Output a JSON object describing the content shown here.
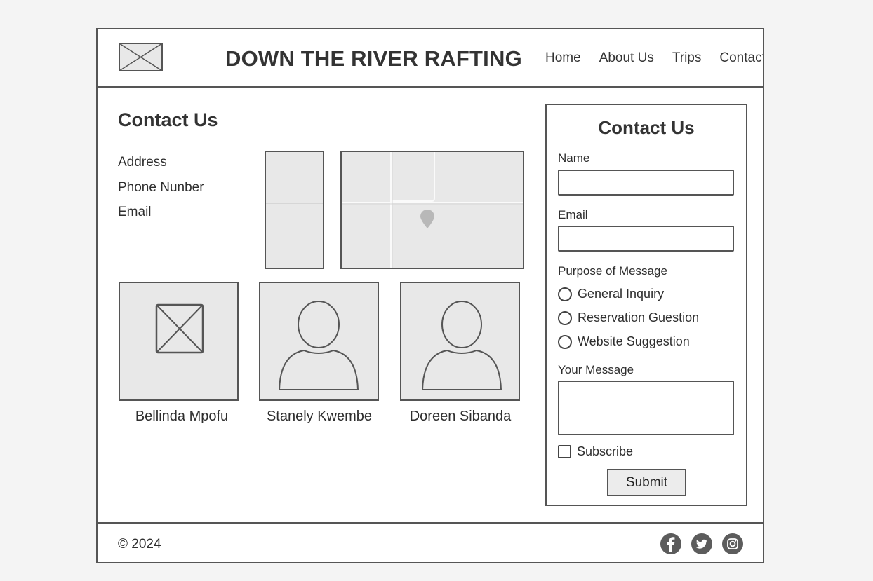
{
  "header": {
    "site_title": "DOWN THE RIVER RAFTING",
    "nav": [
      "Home",
      "About Us",
      "Trips",
      "Contact"
    ]
  },
  "main": {
    "page_title": "Contact Us",
    "info": [
      "Address",
      "Phone Nunber",
      "Email"
    ],
    "team": [
      {
        "name": "Bellinda Mpofu",
        "image": "image-placeholder-icon"
      },
      {
        "name": "Stanely Kwembe",
        "image": "person-silhouette-icon"
      },
      {
        "name": "Doreen Sibanda",
        "image": "person-silhouette-icon"
      }
    ]
  },
  "form": {
    "title": "Contact Us",
    "name_label": "Name",
    "name_value": "",
    "email_label": "Email",
    "email_value": "",
    "purpose_label": "Purpose of Message",
    "purposes": [
      "General Inquiry",
      "Reservation Guestion",
      "Website Suggestion"
    ],
    "message_label": "Your Message",
    "message_value": "",
    "subscribe_label": "Subscribe",
    "submit_label": "Submit"
  },
  "footer": {
    "copyright": "© 2024",
    "social": [
      "facebook-icon",
      "twitter-icon",
      "instagram-icon"
    ]
  },
  "colors": {
    "border": "#555555",
    "placeholder_fill": "#e8e8e8",
    "text": "#2e2e2e"
  }
}
